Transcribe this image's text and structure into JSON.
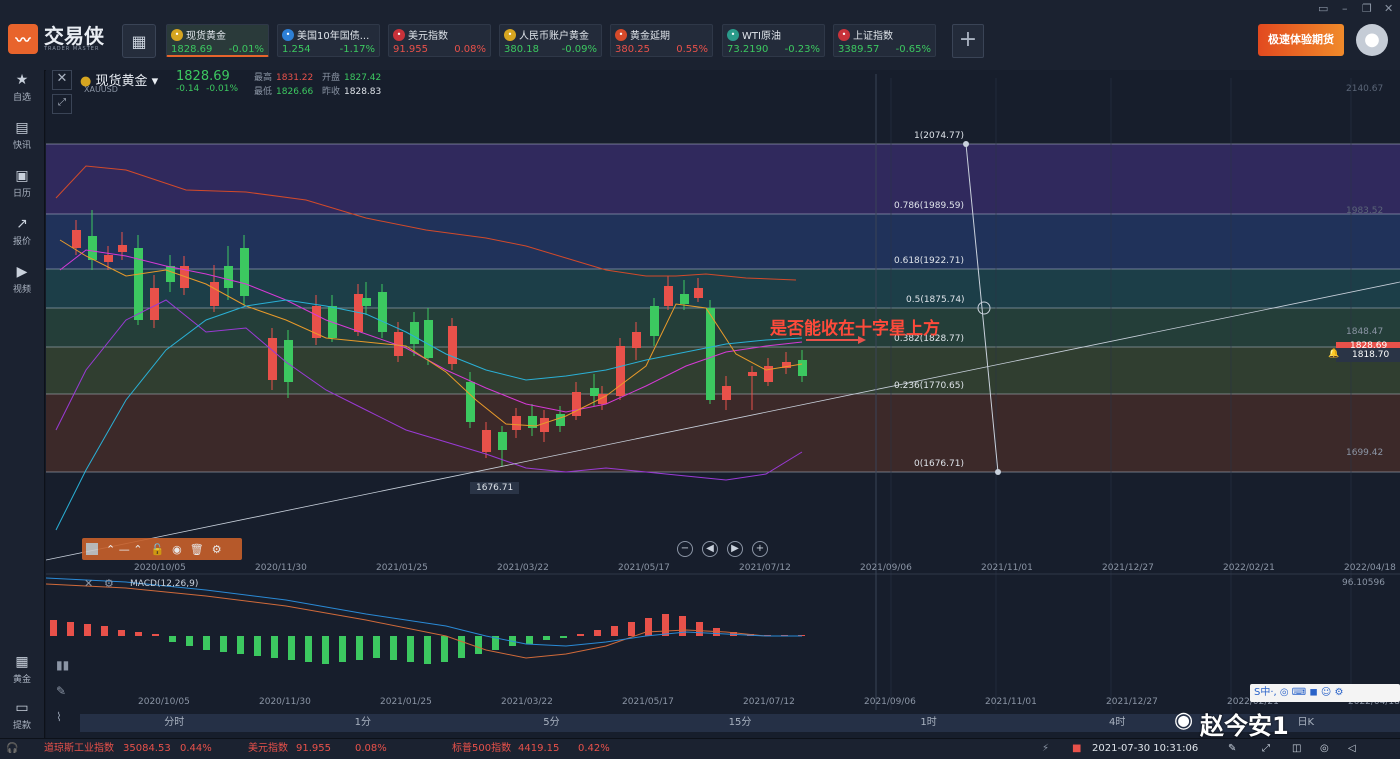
{
  "app": {
    "name": "交易侠",
    "subtitle": "TRADER MASTER"
  },
  "tabs": [
    {
      "name": "现货黄金",
      "price": "1828.69",
      "change": "-0.01%",
      "dir": "dn",
      "icon_color": "#d6a520",
      "icon": "gold-coin-icon"
    },
    {
      "name": "美国10年国债...",
      "price": "1.254",
      "change": "-1.17%",
      "dir": "dn",
      "icon_color": "#2d7fd6",
      "icon": "bar-chart-icon"
    },
    {
      "name": "美元指数",
      "price": "91.955",
      "change": "0.08%",
      "dir": "up",
      "icon_color": "#c8323a",
      "icon": "us-flag-icon"
    },
    {
      "name": "人民币账户黄金",
      "price": "380.18",
      "change": "-0.09%",
      "dir": "dn",
      "icon_color": "#d6a520",
      "icon": "gold-coin-icon"
    },
    {
      "name": "黄金延期",
      "price": "380.25",
      "change": "0.55%",
      "dir": "up",
      "icon_color": "#d64a2a",
      "icon": "gold-bar-icon"
    },
    {
      "name": "WTI原油",
      "price": "73.2190",
      "change": "-0.23%",
      "dir": "dn",
      "icon_color": "#2a9a8a",
      "icon": "oil-icon"
    },
    {
      "name": "上证指数",
      "price": "3389.57",
      "change": "-0.65%",
      "dir": "dn",
      "icon_color": "#c8323a",
      "icon": "index-icon"
    }
  ],
  "promo": "极速体验期货",
  "sidebar": [
    {
      "label": "自选",
      "icon": "bookmark-icon"
    },
    {
      "label": "快讯",
      "icon": "news-icon"
    },
    {
      "label": "日历",
      "icon": "calendar-icon"
    },
    {
      "label": "报价",
      "icon": "quote-icon"
    },
    {
      "label": "视频",
      "icon": "video-icon"
    },
    {
      "label": "黄金",
      "icon": "gold-icon"
    },
    {
      "label": "提款",
      "icon": "wallet-icon"
    }
  ],
  "symbol": {
    "name": "现货黄金",
    "code": "XAUUSD",
    "price": "1828.69",
    "change": "-0.14",
    "change_pct": "-0.01%",
    "high_label": "最高",
    "high": "1831.22",
    "open_label": "开盘",
    "open": "1827.42",
    "low_label": "最低",
    "low": "1826.66",
    "prev_label": "昨收",
    "prev": "1828.83"
  },
  "fib_labels": [
    "1(2074.77)",
    "0.786(1989.59)",
    "0.618(1922.71)",
    "0.5(1875.74)",
    "0.382(1828.77)",
    "0.236(1770.65)",
    "0(1676.71)"
  ],
  "right_axis": [
    "2140.67",
    "1983.52",
    "1848.47",
    "1828.69",
    "1818.70",
    "1699.42"
  ],
  "annotation": "是否能收在十字星上方",
  "low_marker": "1676.71",
  "macd": {
    "label": "MACD(12,26,9)",
    "right_value": "96.10596"
  },
  "x_dates": [
    "2020/10/05",
    "2020/11/30",
    "2021/01/25",
    "2021/03/22",
    "2021/05/17",
    "2021/07/12",
    "2021/09/06",
    "2021/11/01",
    "2021/12/27",
    "2022/02/21",
    "2022/04/18"
  ],
  "periods": [
    "分时",
    "1分",
    "5分",
    "15分",
    "1时",
    "4时",
    "日K"
  ],
  "ticker": [
    {
      "name": "道琼斯工业指数",
      "value": "35084.53",
      "pct": "0.44%"
    },
    {
      "name": "美元指数",
      "value": "91.955",
      "pct": "0.08%"
    },
    {
      "name": "标普500指数",
      "value": "4419.15",
      "pct": "0.42%"
    }
  ],
  "datetime": "2021-07-30 10:31:06",
  "watermark": "赵今安1",
  "ime": "S中·, ◎ ⌨ ◼ ☺ ⚙",
  "colors": {
    "up": "#e8514a",
    "down": "#3cc860",
    "accent": "#e8642c"
  }
}
